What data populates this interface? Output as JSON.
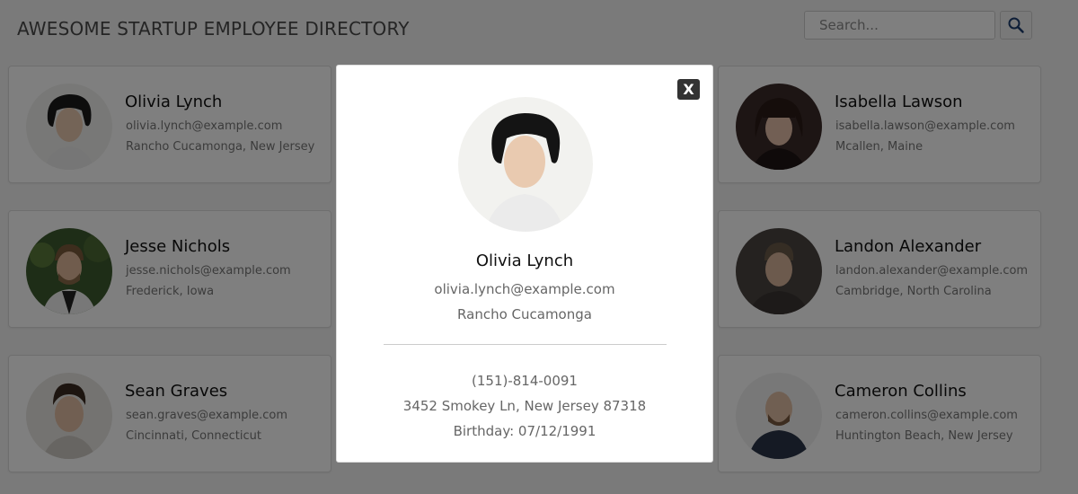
{
  "header": {
    "title": "AWESOME STARTUP EMPLOYEE DIRECTORY",
    "search_placeholder": "Search...",
    "search_icon": "search-icon"
  },
  "employees": [
    {
      "name": "Olivia Lynch",
      "email": "olivia.lynch@example.com",
      "location": "Rancho Cucamonga, New Jersey"
    },
    {
      "name": "Isabella Lawson",
      "email": "isabella.lawson@example.com",
      "location": "Mcallen, Maine"
    },
    {
      "name": "Jesse Nichols",
      "email": "jesse.nichols@example.com",
      "location": "Frederick, Iowa"
    },
    {
      "name": "Landon Alexander",
      "email": "landon.alexander@example.com",
      "location": "Cambridge, North Carolina"
    },
    {
      "name": "Sean Graves",
      "email": "sean.graves@example.com",
      "location": "Cincinnati, Connecticut"
    },
    {
      "name": "Cameron Collins",
      "email": "cameron.collins@example.com",
      "location": "Huntington Beach, New Jersey"
    }
  ],
  "modal": {
    "close_label": "X",
    "name": "Olivia Lynch",
    "email": "olivia.lynch@example.com",
    "city": "Rancho Cucamonga",
    "phone": "(151)-814-0091",
    "address": "3452 Smokey Ln, New Jersey 87318",
    "birthday": "Birthday: 07/12/1991"
  },
  "colors": {
    "overlay": "#000000",
    "modal_background": "#ffffff",
    "close_button": "#333333"
  }
}
